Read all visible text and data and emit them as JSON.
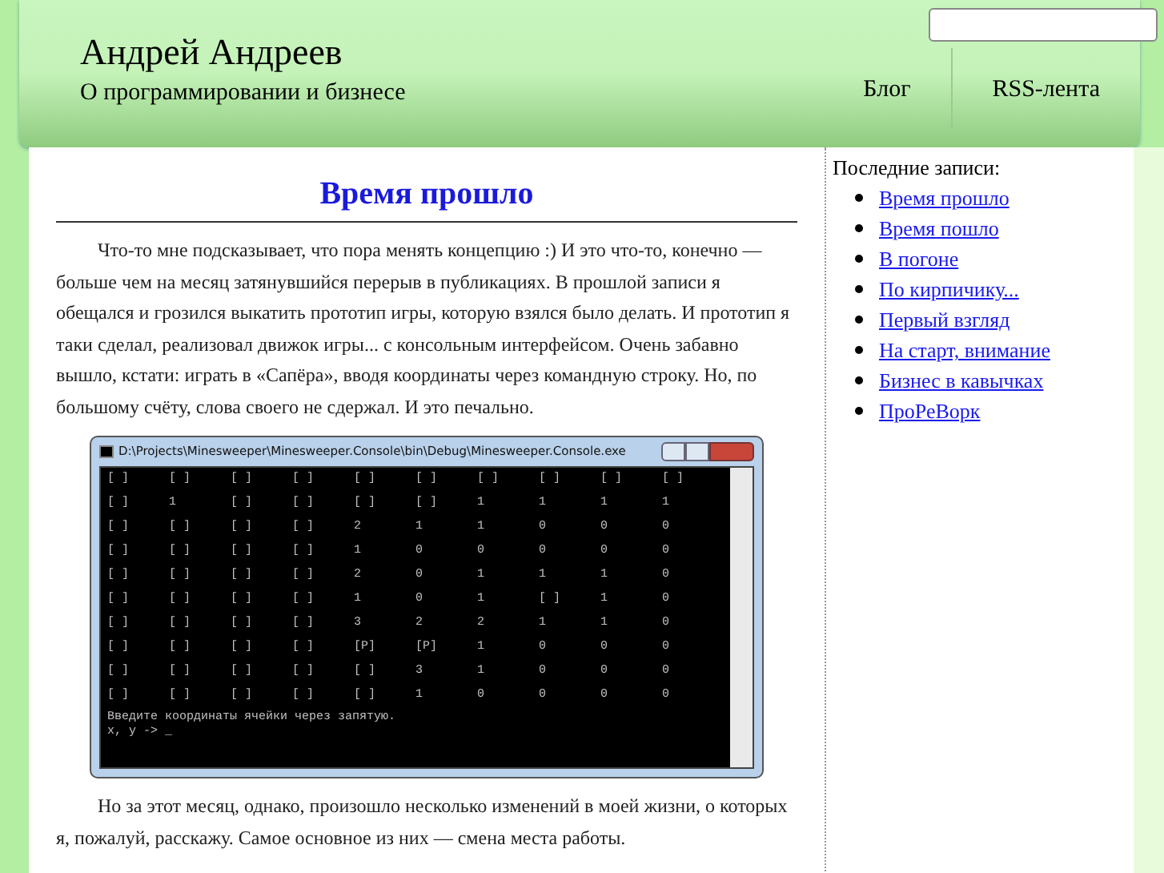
{
  "header": {
    "title": "Андрей Андреев",
    "subtitle": "О программировании и бизнесе",
    "nav": [
      {
        "label": "Блог"
      },
      {
        "label": "RSS-лента"
      }
    ]
  },
  "post": {
    "title": "Время прошло",
    "paragraphs": [
      "Что-то мне подсказывает, что пора менять концепцию :) И это что-то, конечно — больше чем на месяц затянувшийся перерыв в публикациях. В прошлой записи я обещался и грозился выкатить прототип игры, которую взялся было делать. И прототип я таки сделал, реализовал движок игры... с консольным интерфейсом. Очень забавно вышло, кстати: играть в «Сапёра», вводя координаты через командную строку. Но, по большому счёту, слова своего не сдержал. И это печально."
    ],
    "console": {
      "title": "D:\\Projects\\Minesweeper\\Minesweeper.Console\\bin\\Debug\\Minesweeper.Console.exe",
      "rows": [
        [
          "[ ]",
          "[ ]",
          "[ ]",
          "[ ]",
          "[ ]",
          "[ ]",
          "[ ]",
          "[ ]",
          "[ ]",
          "[ ]"
        ],
        [
          "[ ]",
          "1",
          "[ ]",
          "[ ]",
          "[ ]",
          "[ ]",
          "1",
          "1",
          "1",
          "1"
        ],
        [
          "[ ]",
          "[ ]",
          "[ ]",
          "[ ]",
          "2",
          "1",
          "1",
          "0",
          "0",
          "0"
        ],
        [
          "[ ]",
          "[ ]",
          "[ ]",
          "[ ]",
          "1",
          "0",
          "0",
          "0",
          "0",
          "0"
        ],
        [
          "[ ]",
          "[ ]",
          "[ ]",
          "[ ]",
          "2",
          "0",
          "1",
          "1",
          "1",
          "0"
        ],
        [
          "[ ]",
          "[ ]",
          "[ ]",
          "[ ]",
          "1",
          "0",
          "1",
          "[ ]",
          "1",
          "0"
        ],
        [
          "[ ]",
          "[ ]",
          "[ ]",
          "[ ]",
          "3",
          "2",
          "2",
          "1",
          "1",
          "0"
        ],
        [
          "[ ]",
          "[ ]",
          "[ ]",
          "[ ]",
          "[P]",
          "[P]",
          "1",
          "0",
          "0",
          "0"
        ],
        [
          "[ ]",
          "[ ]",
          "[ ]",
          "[ ]",
          "[ ]",
          "3",
          "1",
          "0",
          "0",
          "0"
        ],
        [
          "[ ]",
          "[ ]",
          "[ ]",
          "[ ]",
          "[ ]",
          "1",
          "0",
          "0",
          "0",
          "0"
        ]
      ],
      "lines": [
        "Введите координаты ячейки через запятую.",
        "x, y -> _"
      ]
    },
    "paragraphs_after": [
      "Но за этот месяц, однако, произошло несколько изменений в моей жизни, о которых я, пожалуй, расскажу. Самое основное из них — смена места работы."
    ]
  },
  "sidebar": {
    "heading": "Последние записи:",
    "links": [
      "Время прошло",
      "Время пошло",
      "В погоне",
      "По кирпичику...",
      "Первый взгляд",
      "На старт, внимание",
      "Бизнес в кавычках",
      "ПроРеВорк"
    ]
  }
}
